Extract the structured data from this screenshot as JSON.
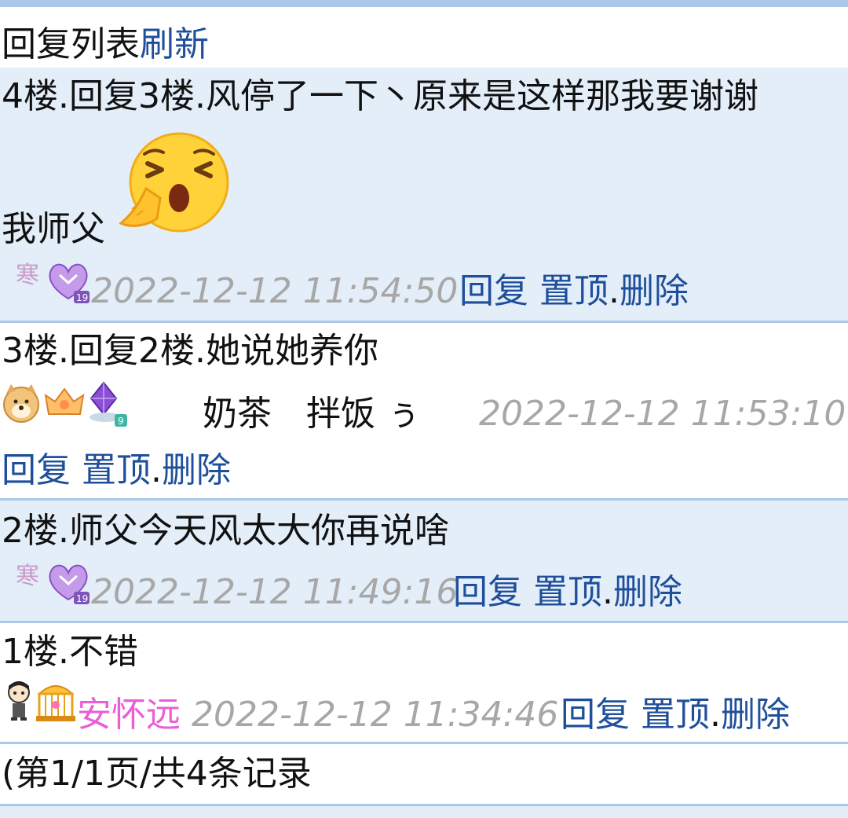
{
  "header": {
    "title": "回复列表",
    "refresh": "刷新"
  },
  "replies": [
    {
      "line1": "4楼.回复3楼.风停了一下丶原来是这样那我要谢谢",
      "line2": "我师父",
      "emoji_icon": "crying-praying-emoji",
      "badge_icons": [
        "han-text-badge",
        "purple-heart-level-badge"
      ],
      "timestamp": "2022-12-12 11:54:50",
      "reply": "回复",
      "pin": "置顶",
      "dot": ".",
      "delete": "删除"
    },
    {
      "line1": "3楼.回复2楼.她说她养你",
      "badge_icons": [
        "doge-avatar-badge",
        "gold-crown-badge",
        "purple-crystal-level-badge"
      ],
      "username": "奶茶　拌饭 ぅ",
      "timestamp": "2022-12-12 11:53:10",
      "reply": "回复",
      "pin": "置顶",
      "dot": ".",
      "delete": "删除"
    },
    {
      "line1": "2楼.师父今天风太大你再说啥",
      "badge_icons": [
        "han-text-badge",
        "purple-heart-level-badge"
      ],
      "timestamp": "2022-12-12 11:49:16",
      "reply": "回复",
      "pin": "置顶",
      "dot": ".",
      "delete": "删除"
    },
    {
      "line1": "1楼.不错",
      "badge_icons": [
        "cartoon-avatar-badge",
        "golden-cage-badge"
      ],
      "username": "安怀远",
      "timestamp": "2022-12-12 11:34:46",
      "reply": "回复",
      "pin": "置顶",
      "dot": ".",
      "delete": "删除"
    }
  ],
  "pagination": {
    "text": "(第1/1页/共4条记录"
  },
  "colors": {
    "link": "#1f4f9a",
    "timestamp": "#a7a7a7",
    "row_shade": "#e3eef9",
    "separator": "#a9c8ea",
    "username_pink": "#e85fd6"
  }
}
